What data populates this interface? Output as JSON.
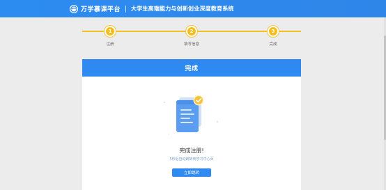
{
  "header": {
    "brand_name": "万学慕课平台",
    "subtitle": "大学生高端能力与创新创业深度教育系统"
  },
  "steps": [
    {
      "number": "1",
      "label": "注册"
    },
    {
      "number": "2",
      "label": "填写信息"
    },
    {
      "number": "3",
      "label": "完成"
    }
  ],
  "card": {
    "title": "完成",
    "success_title": "完成注册!",
    "success_subtitle": "5秒后自动跳转到学习中心页",
    "button_label": "立即跳转"
  },
  "colors": {
    "primary": "#2e89f0",
    "step": "#f5bd1d",
    "background": "#ececec"
  },
  "icons": {
    "logo": "brand-logo-icon",
    "document": "document-icon",
    "check": "check-icon"
  }
}
